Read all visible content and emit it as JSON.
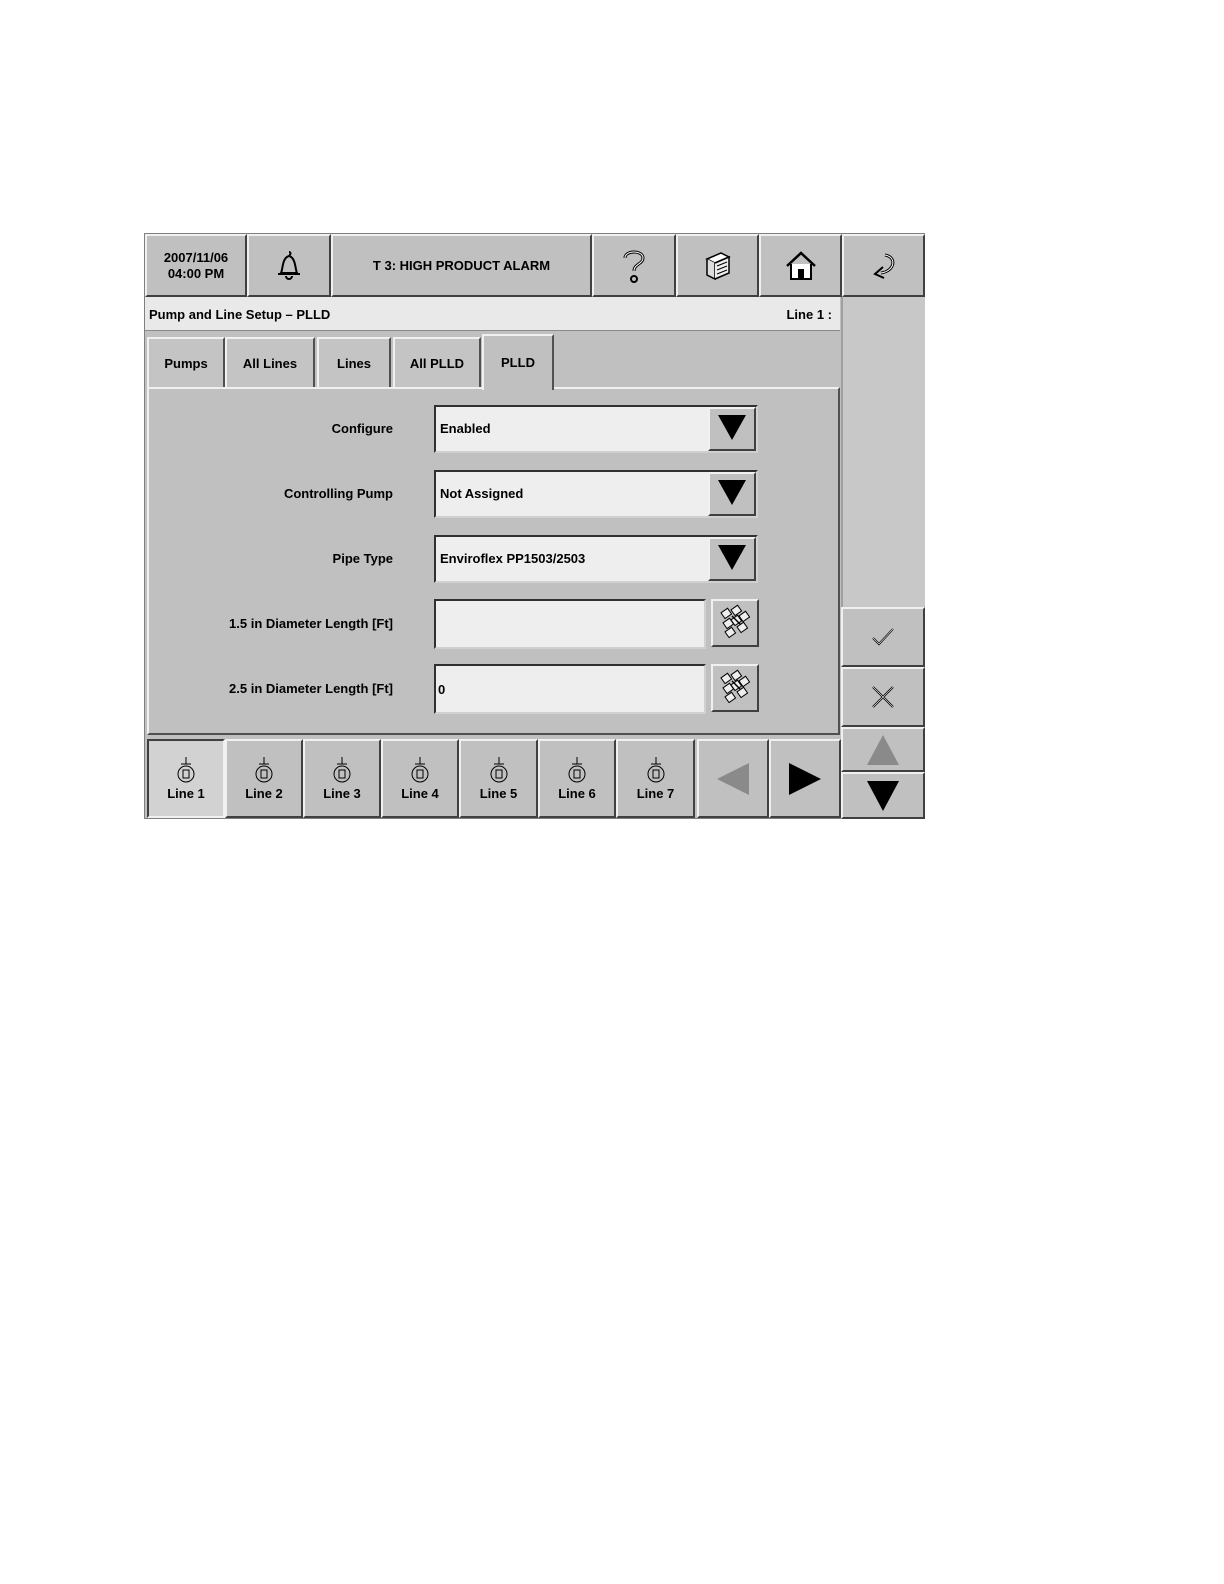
{
  "header": {
    "date": "2007/11/06",
    "time": "04:00 PM",
    "alarm_text": "T 3: HIGH PRODUCT ALARM",
    "icons": [
      "bell-icon",
      "help-icon",
      "reports-icon",
      "home-icon",
      "back-icon"
    ]
  },
  "title": {
    "left": "Pump and Line Setup – PLLD",
    "right": "Line 1 :"
  },
  "tabs": [
    {
      "label": "Pumps"
    },
    {
      "label": "All Lines"
    },
    {
      "label": "Lines"
    },
    {
      "label": "All PLLD"
    },
    {
      "label": "PLLD",
      "active": true
    }
  ],
  "form": {
    "configure": {
      "label": "Configure",
      "value": "Enabled"
    },
    "controlling_pump": {
      "label": "Controlling Pump",
      "value": "Not Assigned"
    },
    "pipe_type": {
      "label": "Pipe Type",
      "value": "Enviroflex PP1503/2503"
    },
    "length_15": {
      "label": "1.5 in Diameter Length [Ft]",
      "value": ""
    },
    "length_25": {
      "label": "2.5 in Diameter Length [Ft]",
      "value": "0"
    }
  },
  "lines": [
    {
      "label": "Line 1",
      "active": true
    },
    {
      "label": "Line 2"
    },
    {
      "label": "Line 3"
    },
    {
      "label": "Line 4"
    },
    {
      "label": "Line 5"
    },
    {
      "label": "Line 6"
    },
    {
      "label": "Line 7"
    }
  ],
  "side_buttons": [
    "checkmark-icon",
    "x-icon",
    "arrow-up-icon",
    "arrow-down-icon"
  ],
  "colors": {
    "face": "#c0c0c0",
    "field": "#eeeeee",
    "title_bar": "#e9e9e9"
  }
}
